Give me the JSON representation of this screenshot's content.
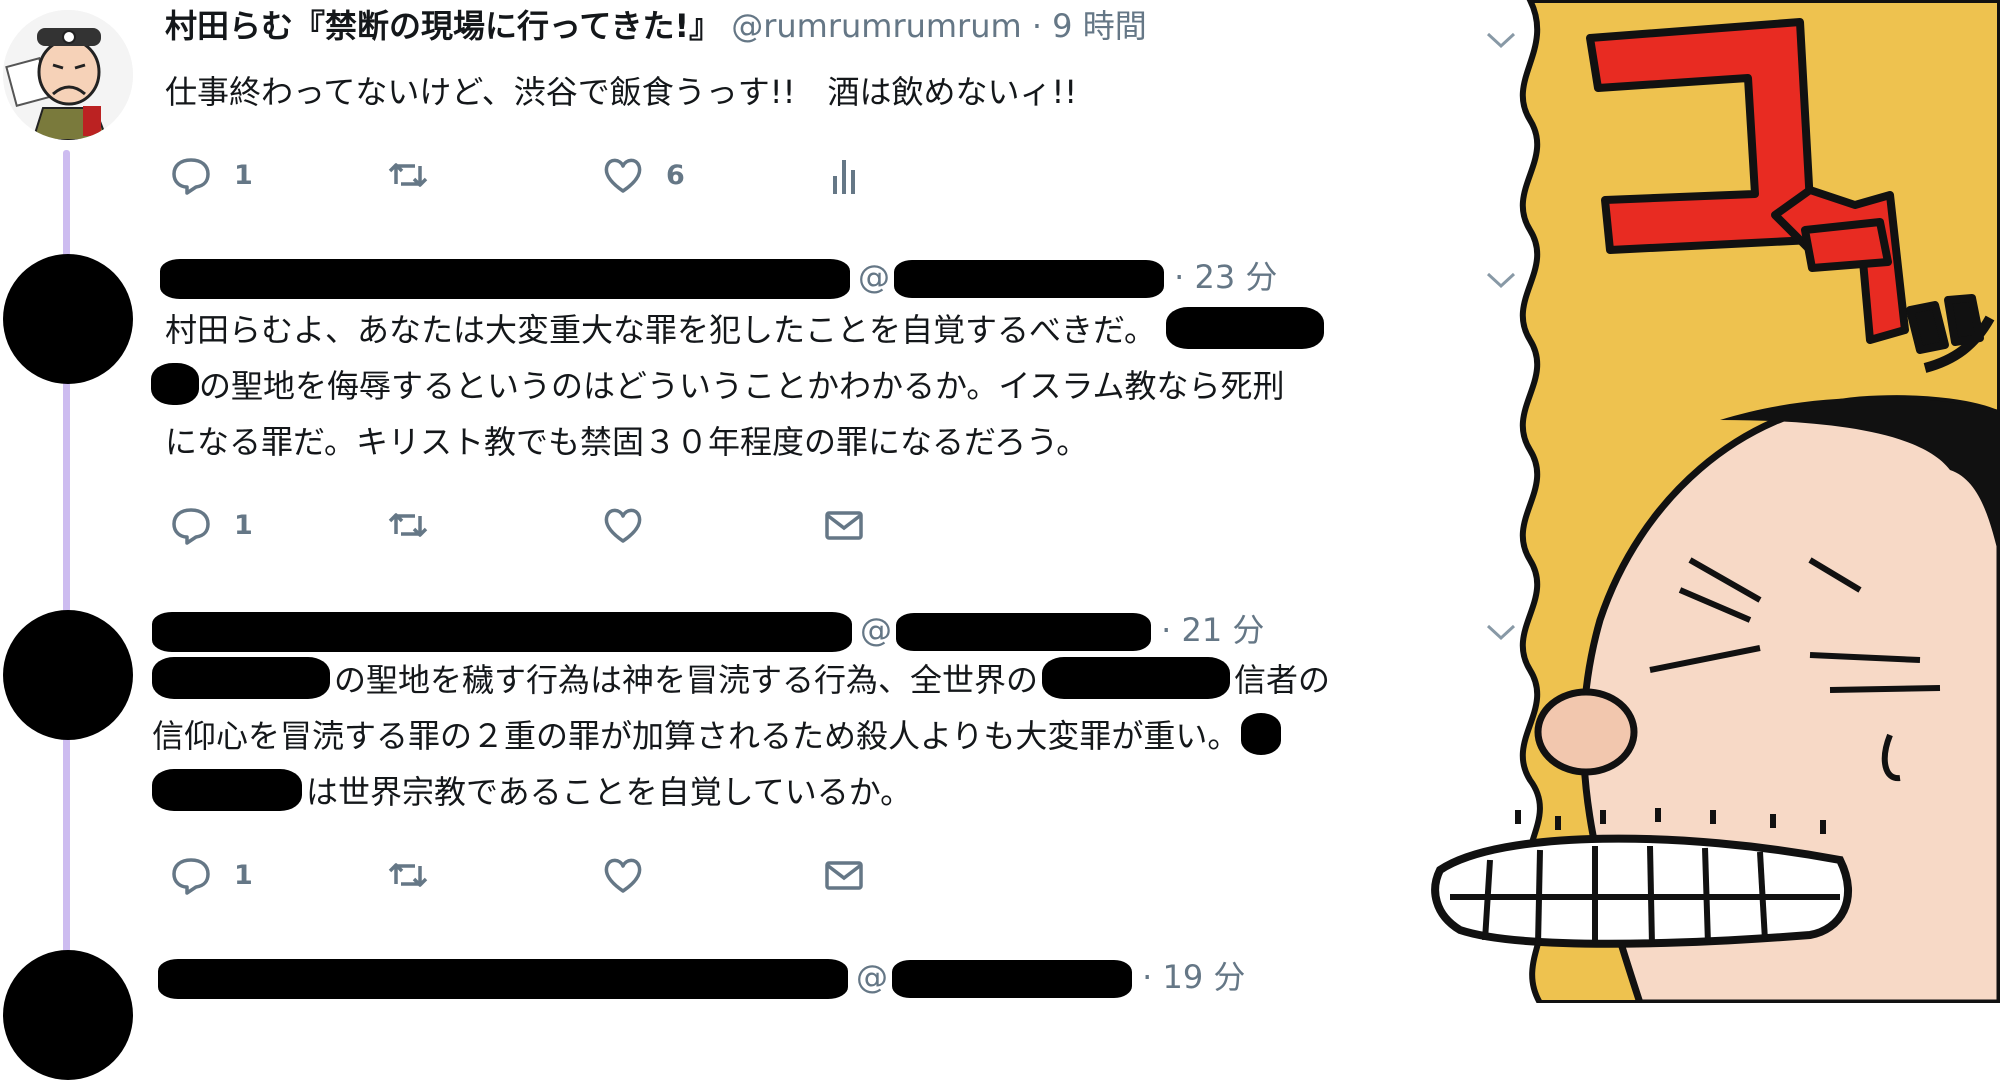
{
  "tweets": [
    {
      "name": "村田らむ『禁断の現場に行ってきた!』",
      "handle": "@rumrumrumrum",
      "time": "· 9 時間",
      "text": "仕事終わってないけど、渋谷で飯食うっす!!　酒は飲めないィ!!",
      "reply_count": "1",
      "like_count": "6"
    },
    {
      "handle_prefix": "@",
      "time": "· 23 分",
      "line1_a": "村田らむよ、あなたは大変重大な罪を犯したことを自覚するべきだ。",
      "line2_b": "の聖地を侮辱するというのはどういうことかわかるか。イスラム教なら死刑",
      "line3": "になる罪だ。キリスト教でも禁固３０年程度の罪になるだろう。",
      "reply_count": "1"
    },
    {
      "handle_prefix": "@",
      "time": "· 21 分",
      "line1_a": "の聖地を穢す行為は神を冒涜する行為、全世界の",
      "line1_b": "信者の",
      "line2": "信仰心を冒涜する罪の２重の罪が加算されるため殺人よりも大変罪が重い。",
      "line3_b": "は世界宗教であることを自覚しているか。",
      "reply_count": "1"
    },
    {
      "handle_prefix": "@",
      "time": "· 19 分"
    }
  ],
  "comic": {
    "sfx": "コワッ",
    "colors": {
      "burst": "#eec24f",
      "sfx_red": "#e82b22",
      "skin": "#f7d9c6"
    }
  },
  "colors": {
    "thread_line": "#cdbcf0",
    "meta_gray": "#657786"
  },
  "icons": [
    "reply-icon",
    "retweet-icon",
    "like-icon",
    "analytics-icon",
    "dm-icon",
    "chevron-down-icon"
  ]
}
